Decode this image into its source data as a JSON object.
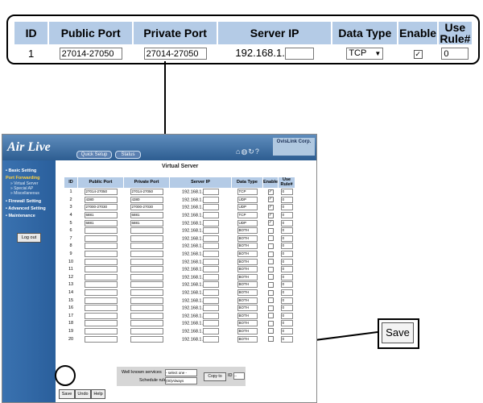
{
  "zoom": {
    "headers": [
      "ID",
      "Public Port",
      "Private Port",
      "Server IP",
      "Data Type",
      "Enable",
      "Use Rule#"
    ],
    "row": {
      "id": "1",
      "public_port": "27014-27050",
      "private_port": "27014-27050",
      "ip_prefix": "192.168.1.",
      "ip_last": "",
      "data_type": "TCP",
      "enabled": "✓",
      "rule": "0"
    }
  },
  "router": {
    "logo": "Air Live",
    "quick_setup": "Quick Setup",
    "status": "Status",
    "corp": "OvisLink Corp.",
    "sidebar": {
      "basic_setting": "• Basic Setting",
      "port_forwarding": "Port Forwarding",
      "virtual_server": "» Virtual Server",
      "special_ap": "» Special AP",
      "miscellaneous": "» Miscellaneous",
      "firewall_setting": "• Firewall Setting",
      "advanced_setting": "• Advanced Setting",
      "maintenance": "• Maintenance",
      "logout": "Log out"
    },
    "page_title": "Virtual Server",
    "table_headers": [
      "ID",
      "Public Port",
      "Private Port",
      "Server IP",
      "Data Type",
      "Enable",
      "Use Rule#"
    ],
    "rows": [
      {
        "id": "1",
        "pub": "27014-27050",
        "priv": "27014-27050",
        "type": "TCP",
        "en": "✓",
        "rule": "0"
      },
      {
        "id": "2",
        "pub": "4380",
        "priv": "4380",
        "type": "UDP",
        "en": "✓",
        "rule": "0"
      },
      {
        "id": "3",
        "pub": "27000-27030",
        "priv": "27000-27030",
        "type": "UDP",
        "en": "✓",
        "rule": "0"
      },
      {
        "id": "4",
        "pub": "6881",
        "priv": "6881",
        "type": "TCP",
        "en": "✓",
        "rule": "0"
      },
      {
        "id": "5",
        "pub": "6881",
        "priv": "6881",
        "type": "UDP",
        "en": "✓",
        "rule": "0"
      },
      {
        "id": "6",
        "pub": "",
        "priv": "",
        "type": "BOTH",
        "en": "",
        "rule": "0"
      },
      {
        "id": "7",
        "pub": "",
        "priv": "",
        "type": "BOTH",
        "en": "",
        "rule": "0"
      },
      {
        "id": "8",
        "pub": "",
        "priv": "",
        "type": "BOTH",
        "en": "",
        "rule": "0"
      },
      {
        "id": "9",
        "pub": "",
        "priv": "",
        "type": "BOTH",
        "en": "",
        "rule": "0"
      },
      {
        "id": "10",
        "pub": "",
        "priv": "",
        "type": "BOTH",
        "en": "",
        "rule": "0"
      },
      {
        "id": "11",
        "pub": "",
        "priv": "",
        "type": "BOTH",
        "en": "",
        "rule": "0"
      },
      {
        "id": "12",
        "pub": "",
        "priv": "",
        "type": "BOTH",
        "en": "",
        "rule": "0"
      },
      {
        "id": "13",
        "pub": "",
        "priv": "",
        "type": "BOTH",
        "en": "",
        "rule": "0"
      },
      {
        "id": "14",
        "pub": "",
        "priv": "",
        "type": "BOTH",
        "en": "",
        "rule": "0"
      },
      {
        "id": "15",
        "pub": "",
        "priv": "",
        "type": "BOTH",
        "en": "",
        "rule": "0"
      },
      {
        "id": "16",
        "pub": "",
        "priv": "",
        "type": "BOTH",
        "en": "",
        "rule": "0"
      },
      {
        "id": "17",
        "pub": "",
        "priv": "",
        "type": "BOTH",
        "en": "",
        "rule": "0"
      },
      {
        "id": "18",
        "pub": "",
        "priv": "",
        "type": "BOTH",
        "en": "",
        "rule": "0"
      },
      {
        "id": "19",
        "pub": "",
        "priv": "",
        "type": "BOTH",
        "en": "",
        "rule": "0"
      },
      {
        "id": "20",
        "pub": "",
        "priv": "",
        "type": "BOTH",
        "en": "",
        "rule": "0"
      }
    ],
    "ip_prefix": "192.168.1.",
    "well_known_label": "Well known services",
    "select_one": "- select one -",
    "schedule_label": "Schedule rule",
    "schedule_value": "(00)Always",
    "copy_to": "Copy to",
    "id_label": "ID",
    "id_value": "--",
    "save": "Save",
    "undo": "Undo",
    "help": "Help"
  },
  "save_callout": "Save"
}
